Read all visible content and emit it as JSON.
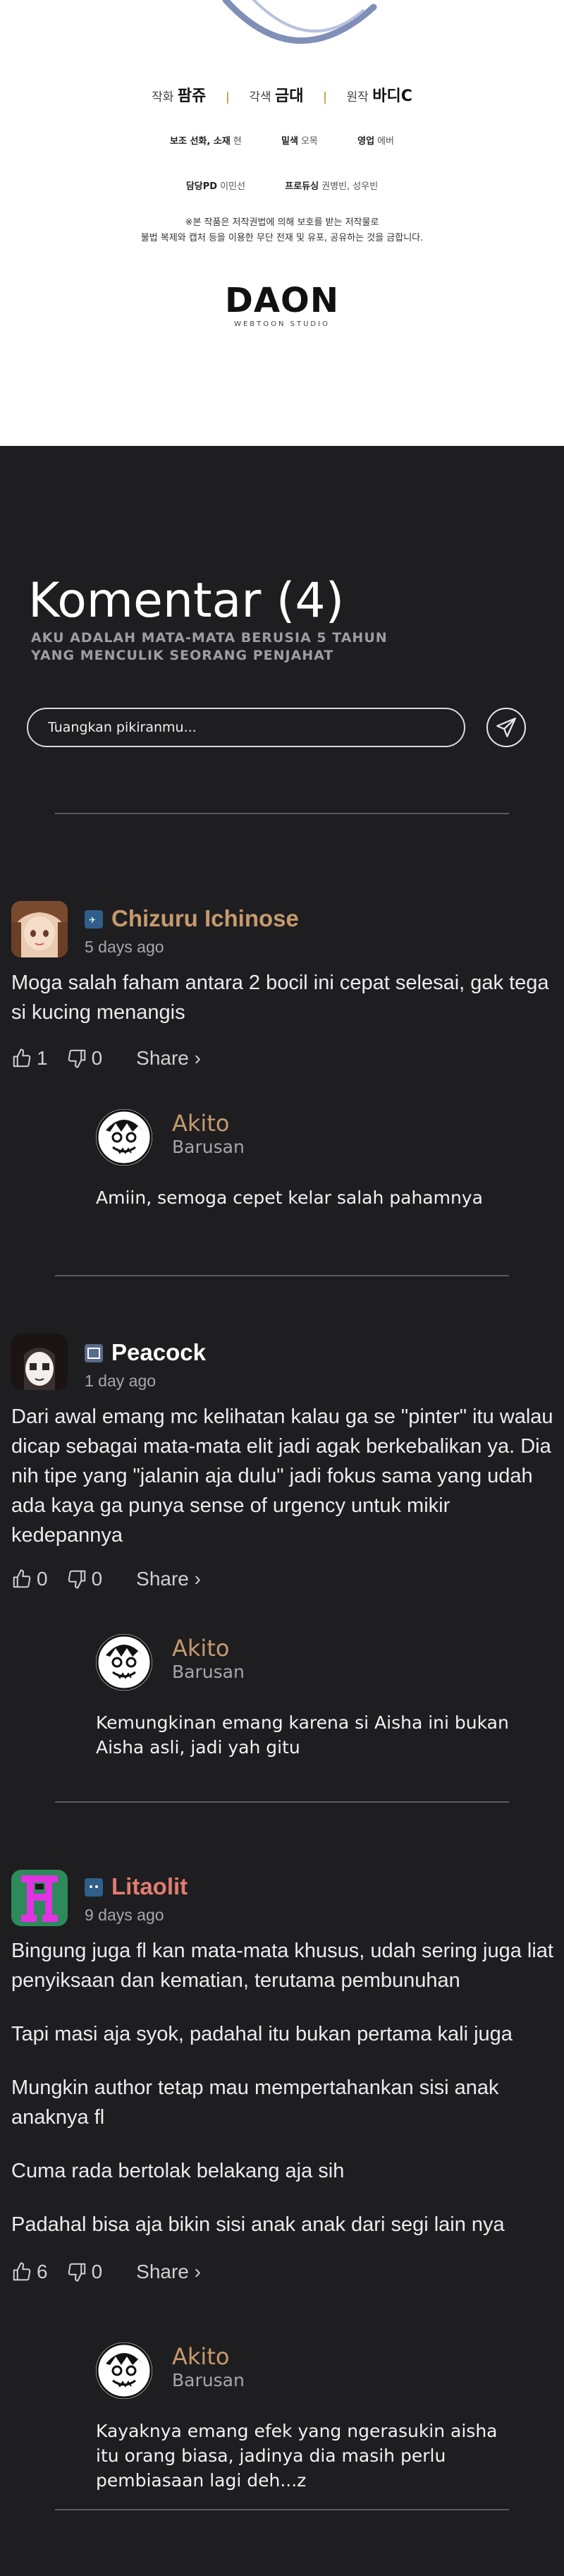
{
  "credits": {
    "writer_role": "작화",
    "writer_name": "팜쥬",
    "adapt_role": "각색",
    "adapt_name": "금대",
    "original_role": "원작",
    "original_name": "바디C",
    "assist_role": "보조 선화, 소재",
    "assist_name": "현",
    "ink_role": "밑색",
    "ink_name": "오목",
    "sales_role": "영업",
    "sales_name": "에버",
    "pd_role": "담당PD",
    "pd_name": "이민선",
    "producing_role": "프로듀싱",
    "producing_name": "권병빈, 성우빈",
    "notice_1": "※본 작품은 저작권법에 의해 보호를 받는 저작물로",
    "notice_2": "불법 복제와 캡처 등을 이용한 무단 전재 및 유포, 공유하는 것을 금합니다.",
    "logo": "DAON",
    "logo_sub": "WEBTOON STUDIO"
  },
  "comments_section": {
    "title": "Komentar (4)",
    "subtitle": "AKU ADALAH MATA-MATA BERUSIA 5 TAHUN YANG MENCULIK SEORANG PENJAHAT",
    "input_placeholder": "Tuangkan pikiranmu...",
    "send_icon": "paper-plane-icon"
  },
  "comments": [
    {
      "username": "Chizuru Ichinose",
      "name_color": "#c69a6c",
      "time": "5 days ago",
      "paragraphs": [
        "Moga salah faham antara 2 bocil ini cepat selesai, gak tega si kucing menangis"
      ],
      "likes": "1",
      "dislikes": "0",
      "share": "Share ›",
      "reply": {
        "username": "Akito",
        "time": "Barusan",
        "text": "Amiin, semoga cepet kelar salah pahamnya"
      }
    },
    {
      "username": "Peacock",
      "name_color": "#ffffff",
      "time": "1 day ago",
      "paragraphs": [
        "Dari awal emang mc kelihatan kalau ga se \"pinter\" itu walau dicap sebagai mata-mata elit jadi agak berkebalikan ya. Dia nih tipe yang \"jalanin aja dulu\" jadi fokus sama yang udah ada kaya ga punya sense of urgency untuk mikir kedepannya"
      ],
      "likes": "0",
      "dislikes": "0",
      "share": "Share ›",
      "reply": {
        "username": "Akito",
        "time": "Barusan",
        "text": "Kemungkinan emang karena si Aisha ini bukan Aisha asli, jadi yah gitu"
      }
    },
    {
      "username": "Litaolit",
      "name_color": "#e27d6e",
      "time": "9 days ago",
      "paragraphs": [
        "Bingung juga fl kan mata-mata khusus, udah sering juga liat penyiksaan dan kematian, terutama pembunuhan",
        "Tapi masi aja syok, padahal itu bukan pertama kali juga",
        "Mungkin author tetap mau mempertahankan sisi anak anaknya fl",
        "Cuma rada bertolak belakang aja sih",
        "Padahal bisa aja bikin sisi anak anak dari segi lain nya"
      ],
      "likes": "6",
      "dislikes": "0",
      "share": "Share ›",
      "reply": {
        "username": "Akito",
        "time": "Barusan",
        "text": "Kayaknya emang efek yang ngerasukin aisha itu orang biasa, jadinya dia masih perlu pembiasaan lagi deh...z"
      }
    }
  ],
  "colors": {
    "background": "#1e1e21",
    "reply_name": "#c69a6c",
    "divider": "#5a5a60"
  }
}
